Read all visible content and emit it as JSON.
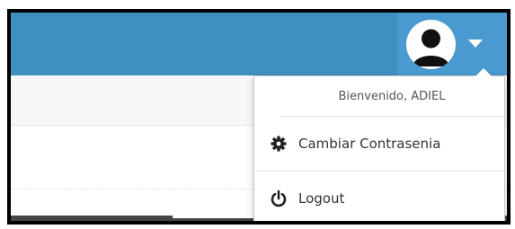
{
  "user_menu": {
    "welcome_text": "Bienvenido, ADIEL",
    "items": [
      {
        "label": "Cambiar Contrasenia",
        "icon": "gear-icon"
      },
      {
        "label": "Logout",
        "icon": "power-icon"
      }
    ]
  },
  "colors": {
    "topbar": "#3f8fbf",
    "user_toggle": "#4a9ad0"
  }
}
